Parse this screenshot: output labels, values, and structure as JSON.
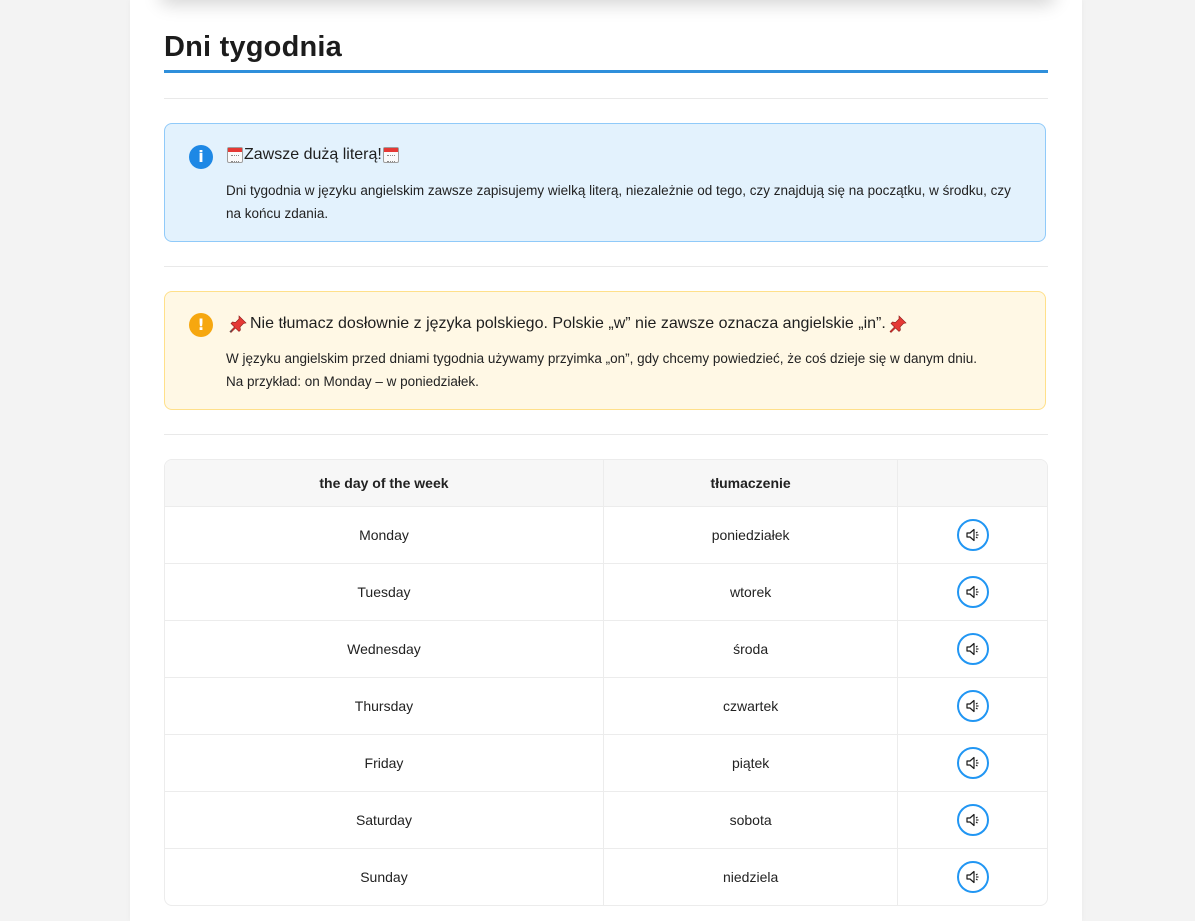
{
  "title": "Dni tygodnia",
  "colors": {
    "accent": "#2f8fdb",
    "info_bg": "#e3f2fd",
    "info_border": "#90caf9",
    "info_icon": "#1e88e5",
    "warn_bg": "#fff8e5",
    "warn_border": "#ffe08a",
    "warn_icon": "#f6a70f",
    "audio_button": "#2196f3"
  },
  "info_callout": {
    "icon": "info-icon",
    "badge_glyph": "i",
    "title": "Zawsze dużą literą!",
    "title_icons": [
      "calendar-icon",
      "calendar-icon"
    ],
    "body": "Dni tygodnia w języku angielskim zawsze zapisujemy wielką literą, niezależnie od tego, czy znajdują się na początku, w środku, czy na końcu zdania."
  },
  "warn_callout": {
    "icon": "exclamation-icon",
    "badge_glyph": "!",
    "title": "Nie tłumacz dosłownie z języka polskiego. Polskie „w” nie zawsze oznacza angielskie „in”.",
    "title_icons": [
      "pushpin-icon",
      "pushpin-icon"
    ],
    "body_line1": "W języku angielskim przed dniami tygodnia używamy przyimka „on”, gdy chcemy powiedzieć, że coś dzieje się w danym dniu.",
    "body_line2": "Na przykład: on Monday – w poniedziałek."
  },
  "table": {
    "headers": [
      "the day of the week",
      "tłumaczenie",
      ""
    ],
    "rows": [
      {
        "en": "Monday",
        "pl": "poniedziałek"
      },
      {
        "en": "Tuesday",
        "pl": "wtorek"
      },
      {
        "en": "Wednesday",
        "pl": "środa"
      },
      {
        "en": "Thursday",
        "pl": "czwartek"
      },
      {
        "en": "Friday",
        "pl": "piątek"
      },
      {
        "en": "Saturday",
        "pl": "sobota"
      },
      {
        "en": "Sunday",
        "pl": "niedziela"
      }
    ],
    "audio_icon": "speaker-icon"
  }
}
